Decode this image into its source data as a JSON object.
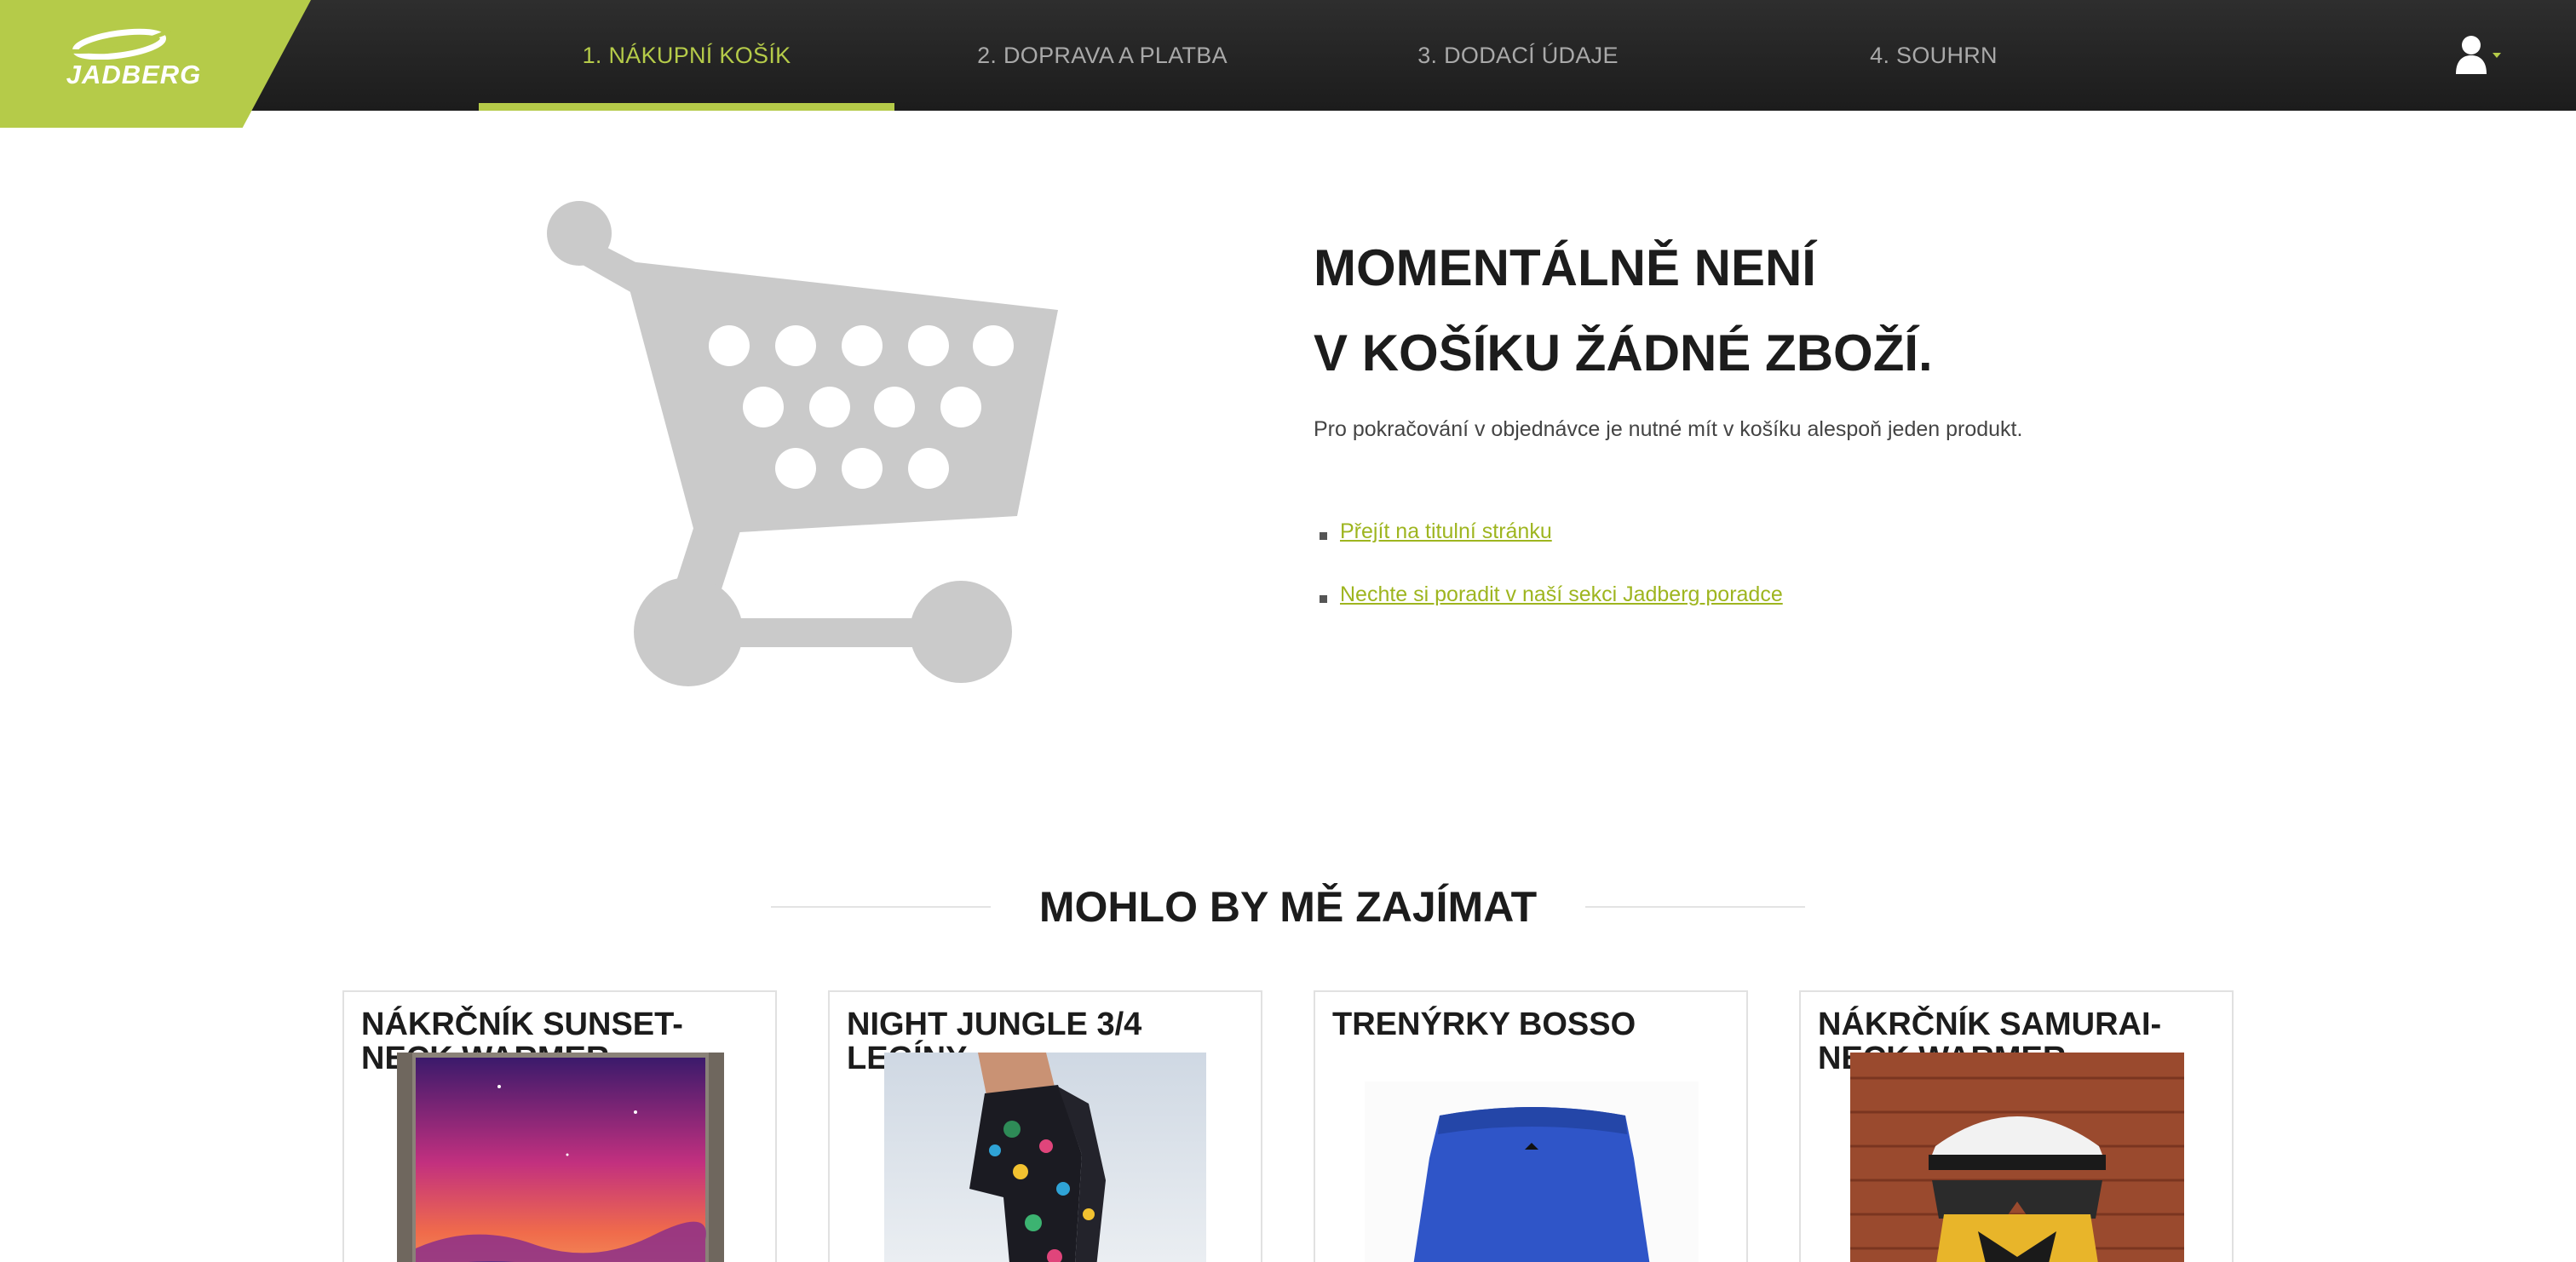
{
  "brand": {
    "name": "JADBERG",
    "accent_color": "#b5cb49",
    "header_color": "#242424"
  },
  "checkout_steps": [
    {
      "label": "1. NÁKUPNÍ KOŠÍK",
      "active": true
    },
    {
      "label": "2. DOPRAVA A PLATBA",
      "active": false
    },
    {
      "label": "3. DODACÍ ÚDAJE",
      "active": false
    },
    {
      "label": "4. SOUHRN",
      "active": false
    }
  ],
  "user_menu": {
    "icon": "user-icon",
    "caret": "caret-down-icon"
  },
  "empty_cart": {
    "illustration": "shopping-cart-icon",
    "title_line1": "MOMENTÁLNĚ NENÍ",
    "title_line2": "V KOŠÍKU ŽÁDNÉ ZBOŽÍ.",
    "description": "Pro pokračování v objednávce je nutné mít v košíku alespoň jeden produkt.",
    "links": [
      {
        "label": "Přejít na titulní stránku"
      },
      {
        "label": "Nechte si poradit v naší sekci Jadberg poradce"
      }
    ]
  },
  "recommendations": {
    "heading": "MOHLO BY MĚ ZAJÍMAT",
    "products": [
      {
        "name": "NÁKRČNÍK SUNSET-NECK WARMER",
        "image": "sunset-neck-warmer-photo"
      },
      {
        "name": "NIGHT JUNGLE 3/4 LEGÍNY",
        "image": "night-jungle-leggings-photo"
      },
      {
        "name": "TRENÝRKY BOSSO",
        "image": "bosso-shorts-photo"
      },
      {
        "name": "NÁKRČNÍK SAMURAI-NECK WARMER",
        "image": "samurai-neck-warmer-photo"
      }
    ]
  }
}
